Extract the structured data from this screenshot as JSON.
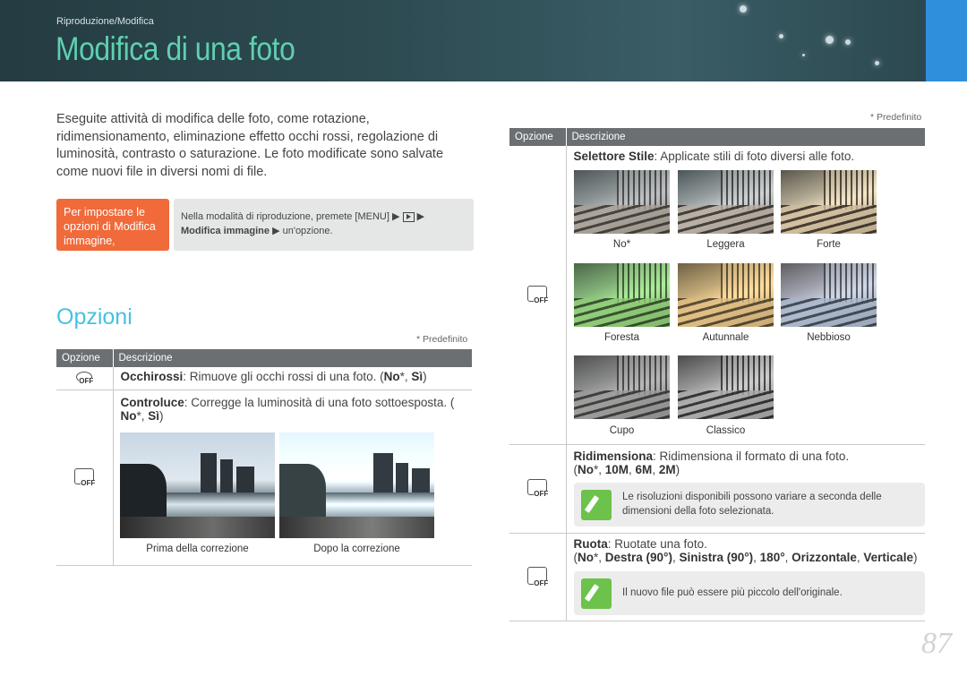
{
  "header": {
    "breadcrumb": "Riproduzione/Modifica",
    "title": "Modifica di una foto"
  },
  "intro": "Eseguite attività di modifica delle foto, come rotazione, ridimensionamento, eliminazione effetto occhi rossi, regolazione di luminosità, contrasto o saturazione. Le foto modificate sono salvate come nuovi file in diversi nomi di file.",
  "howto": {
    "label": "Per impostare le opzioni di Modifica immagine,",
    "text_before": "Nella modalità di riproduzione, premete [MENU] ▶ ",
    "text_after": " ▶",
    "text_line2_bold": "Modifica immagine",
    "text_line2_rest": " ▶ un'opzione."
  },
  "section_title": "Opzioni",
  "predefinito": "* Predefinito",
  "table_headers": {
    "option": "Opzione",
    "description": "Descrizione"
  },
  "left_rows": {
    "redeye": {
      "icon": "red-eye-off-icon",
      "name": "Occhirossi",
      "desc": ": Rimuove gli occhi rossi di una foto. (",
      "v1": "No",
      "star": "*, ",
      "v2": "Sì",
      "end": ")"
    },
    "backlight": {
      "icon": "backlight-off-icon",
      "name": "Controluce",
      "desc": ": Corregge la luminosità di una foto sottoesposta. (",
      "v1": "No",
      "star": "*, ",
      "v2": "Sì",
      "end": ")",
      "cap_before": "Prima della correzione",
      "cap_after": "Dopo la correzione"
    }
  },
  "right_rows": {
    "style": {
      "icon": "photo-style-off-icon",
      "name": "Selettore Stile",
      "desc": ": Applicate stili di foto diversi alle foto.",
      "captions": [
        "No*",
        "Leggera",
        "Forte",
        "Foresta",
        "Autunnale",
        "Nebbioso",
        "Cupo",
        "Classico"
      ]
    },
    "resize": {
      "icon": "resize-off-icon",
      "name": "Ridimensiona",
      "desc": ": Ridimensiona il formato di una foto.",
      "values": "(No*, 10M, 6M, 2M)",
      "v_no": "No",
      "v_star": "*, ",
      "v_10": "10M",
      "v_6": "6M",
      "v_2": "2M",
      "note": "Le risoluzioni disponibili possono variare a seconda delle dimensioni della foto selezionata."
    },
    "rotate": {
      "icon": "rotate-off-icon",
      "name": "Ruota",
      "desc": ": Ruotate una foto.",
      "v_no": "No",
      "v_star": "*, ",
      "v_dx": "Destra (90°)",
      "v_sx": "Sinistra (90°)",
      "v_180": "180°",
      "v_oriz": "Orizzontale",
      "v_vert": "Verticale",
      "note": "Il nuovo file può essere più piccolo dell'originale."
    }
  },
  "page_number": "87",
  "colors": {
    "accent_green": "#5fd0b0",
    "accent_blue": "#46c2e0",
    "orange": "#f06a3a",
    "tab_blue": "#2f8fdd"
  }
}
